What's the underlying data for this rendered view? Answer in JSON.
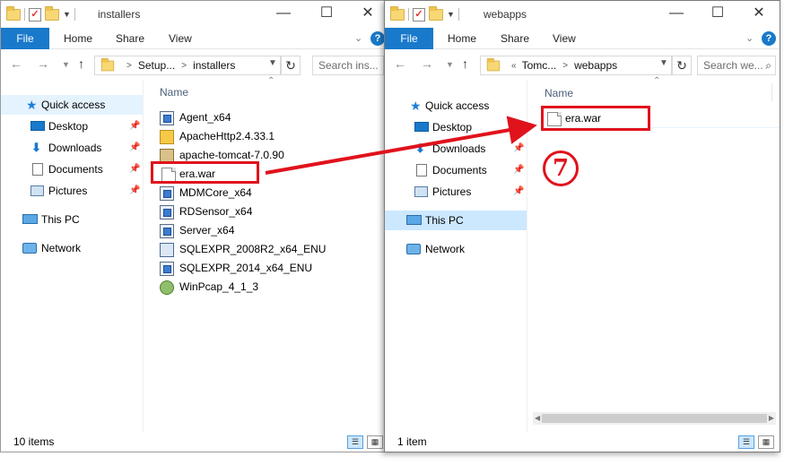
{
  "left_window": {
    "title": "installers",
    "ribbon": {
      "file": "File",
      "home": "Home",
      "share": "Share",
      "view": "View",
      "help": "?"
    },
    "address": {
      "parts": [
        "Setup...",
        "installers"
      ]
    },
    "search_placeholder": "Search ins...",
    "nav": [
      {
        "label": "Quick access",
        "icon": "star-icon",
        "pinned": false
      },
      {
        "label": "Desktop",
        "icon": "desktop-icon",
        "pinned": true
      },
      {
        "label": "Downloads",
        "icon": "downloads-icon",
        "pinned": true
      },
      {
        "label": "Documents",
        "icon": "documents-icon",
        "pinned": true
      },
      {
        "label": "Pictures",
        "icon": "pictures-icon",
        "pinned": true
      },
      {
        "label": "This PC",
        "icon": "pc-icon",
        "pinned": false
      },
      {
        "label": "Network",
        "icon": "network-icon",
        "pinned": false
      }
    ],
    "column_header": "Name",
    "files": [
      {
        "name": "Agent_x64",
        "icon": "installer-icon"
      },
      {
        "name": "ApacheHttp2.4.33.1",
        "icon": "archive-icon"
      },
      {
        "name": "apache-tomcat-7.0.90",
        "icon": "tomcat-icon"
      },
      {
        "name": "era.war",
        "icon": "war-file-icon"
      },
      {
        "name": "MDMCore_x64",
        "icon": "installer-icon"
      },
      {
        "name": "RDSensor_x64",
        "icon": "installer-icon"
      },
      {
        "name": "Server_x64",
        "icon": "installer-icon"
      },
      {
        "name": "SQLEXPR_2008R2_x64_ENU",
        "icon": "msi-icon"
      },
      {
        "name": "SQLEXPR_2014_x64_ENU",
        "icon": "installer-icon"
      },
      {
        "name": "WinPcap_4_1_3",
        "icon": "winpcap-icon"
      }
    ],
    "status": "10 items"
  },
  "right_window": {
    "title": "webapps",
    "ribbon": {
      "file": "File",
      "home": "Home",
      "share": "Share",
      "view": "View",
      "help": "?"
    },
    "address": {
      "prefix": "«",
      "parts": [
        "Tomc...",
        "webapps"
      ]
    },
    "search_placeholder": "Search we...",
    "nav": [
      {
        "label": "Quick access",
        "icon": "star-icon",
        "pinned": false
      },
      {
        "label": "Desktop",
        "icon": "desktop-icon",
        "pinned": true
      },
      {
        "label": "Downloads",
        "icon": "downloads-icon",
        "pinned": true
      },
      {
        "label": "Documents",
        "icon": "documents-icon",
        "pinned": true
      },
      {
        "label": "Pictures",
        "icon": "pictures-icon",
        "pinned": true
      },
      {
        "label": "This PC",
        "icon": "pc-icon",
        "pinned": false
      },
      {
        "label": "Network",
        "icon": "network-icon",
        "pinned": false
      }
    ],
    "column_header": "Name",
    "files": [
      {
        "name": "era.war",
        "icon": "war-file-icon"
      }
    ],
    "status": "1 item"
  },
  "annotation": {
    "step_number": "7",
    "color": "#e0121c"
  },
  "colors": {
    "file_tab": "#1979ca",
    "selection": "#cce8ff",
    "highlight": "#e0121c"
  }
}
